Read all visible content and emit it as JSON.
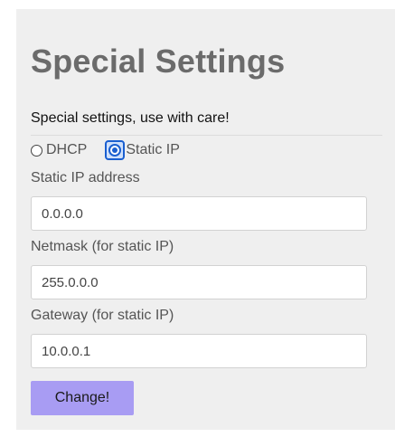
{
  "panel": {
    "title": "Special Settings",
    "subtitle": "Special settings, use with care!"
  },
  "mode": {
    "options": [
      {
        "label": "DHCP",
        "selected": false
      },
      {
        "label": "Static IP",
        "selected": true
      }
    ]
  },
  "fields": {
    "ip": {
      "label": "Static IP address",
      "value": "0.0.0.0"
    },
    "netmask": {
      "label": "Netmask (for static IP)",
      "value": "255.0.0.0"
    },
    "gateway": {
      "label": "Gateway (for static IP)",
      "value": "10.0.0.1"
    }
  },
  "actions": {
    "change_label": "Change!"
  },
  "colors": {
    "panel_bg": "#efefef",
    "title": "#6b6b6b",
    "accent": "#1a5fd0",
    "button_bg": "#a89cf3"
  },
  "icons": {
    "dhcp_radio": "radio-unchecked-icon",
    "static_radio": "radio-checked-icon"
  }
}
